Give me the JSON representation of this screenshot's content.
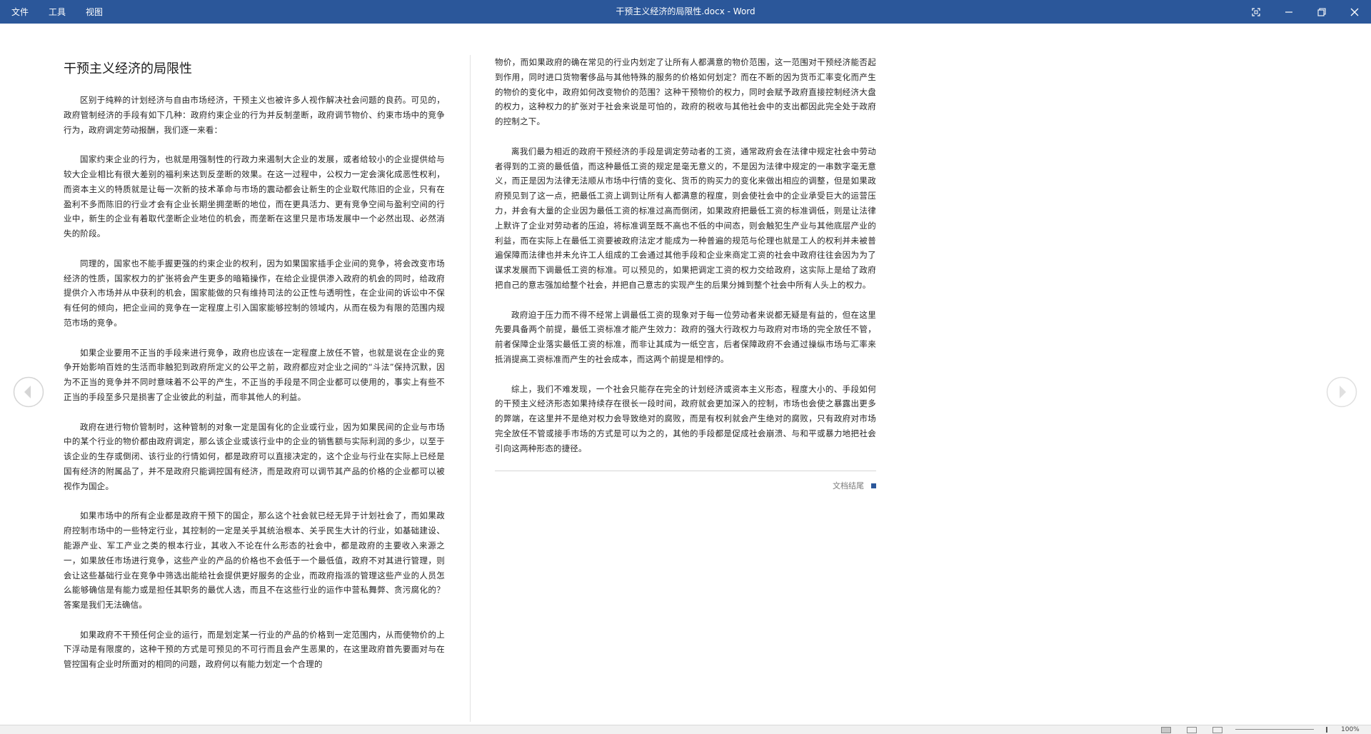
{
  "titlebar": {
    "menu": [
      "文件",
      "工具",
      "视图"
    ],
    "title": "干预主义经济的局限性.docx - Word"
  },
  "document": {
    "heading": "干预主义经济的局限性",
    "left_paragraphs": [
      "区别于纯粹的计划经济与自由市场经济，干预主义也被许多人视作解决社会问题的良药。可见的，政府管制经济的手段有如下几种：政府约束企业的行为并反制垄断，政府调节物价、约束市场中的竞争行为，政府调定劳动报酬，我们逐一来看：",
      "国家约束企业的行为，也就是用强制性的行政力来遏制大企业的发展，或者给较小的企业提供给与较大企业相比有很大差别的福利来达到反垄断的效果。在这一过程中，公权力一定会演化成恶性权利，而资本主义的特质就是让每一次新的技术革命与市场的震动都会让新生的企业取代陈旧的企业，只有在盈利不多而陈旧的行业才会有企业长期坐拥垄断的地位，而在更具活力、更有竞争空间与盈利空间的行业中，新生的企业有着取代垄断企业地位的机会，而垄断在这里只是市场发展中一个必然出现、必然消失的阶段。",
      "同理的，国家也不能手握更强的约束企业的权利，因为如果国家插手企业间的竞争，将会改变市场经济的性质，国家权力的扩张将会产生更多的暗箱操作，在给企业提供渗入政府的机会的同时，给政府提供介入市场并从中获利的机会，国家能做的只有维持司法的公正性与透明性，在企业间的诉讼中不保有任何的倾向，把企业间的竞争在一定程度上引入国家能够控制的领域内，从而在极为有限的范围内规范市场的竞争。",
      "如果企业要用不正当的手段来进行竞争，政府也应该在一定程度上放任不管，也就是说在企业的竞争开始影响百姓的生活而非触犯到政府所定义的公平之前，政府都应对企业之间的“斗法”保持沉默，因为不正当的竞争并不同时意味着不公平的产生，不正当的手段是不同企业都可以使用的，事实上有些不正当的手段至多只是损害了企业彼此的利益，而非其他人的利益。",
      "政府在进行物价管制时，这种管制的对象一定是国有化的企业或行业，因为如果民间的企业与市场中的某个行业的物价都由政府调定，那么该企业或该行业中的企业的销售额与实际利润的多少，以至于该企业的生存或倒闭、该行业的行情如何，都是政府可以直接决定的，这个企业与行业在实际上已经是国有经济的附属品了，并不是政府只能调控国有经济，而是政府可以调节其产品的价格的企业都可以被视作为国企。",
      "如果市场中的所有企业都是政府干预下的国企，那么这个社会就已经无异于计划社会了，而如果政府控制市场中的一些特定行业，其控制的一定是关乎其统治根本、关乎民生大计的行业，如基础建设、能源产业、军工产业之类的根本行业，其收入不论在什么形态的社会中，都是政府的主要收入来源之一，如果放任市场进行竞争，这些产业的产品的价格也不会低于一个最低值，政府不对其进行管理，则会让这些基础行业在竞争中筛选出能给社会提供更好服务的企业，而政府指派的管理这些产业的人员怎么能够确信是有能力或是担任其职务的最优人选，而且不在这些行业的运作中营私舞弊、贪污腐化的？答案是我们无法确信。",
      "如果政府不干预任何企业的运行，而是划定某一行业的产品的价格到一定范围内，从而使物价的上下浮动是有限度的，这种干预的方式是可预见的不可行而且会产生恶果的，在这里政府首先要面对与在管控国有企业时所面对的相同的问题，政府何以有能力划定一个合理的"
    ],
    "right_paragraphs": [
      "物价，而如果政府的确在常见的行业内划定了让所有人都满意的物价范围，这一范围对干预经济能否起到作用，同时进口货物奢侈品与其他特殊的服务的价格如何划定？而在不断的因为货币汇率变化而产生的物价的变化中，政府如何改变物价的范围？这种干预物价的权力，同时会赋予政府直接控制经济大盘的权力，这种权力的扩张对于社会来说是可怕的，政府的税收与其他社会中的支出都因此完全处于政府的控制之下。",
      "离我们最为相近的政府干预经济的手段是调定劳动者的工资，通常政府会在法律中规定社会中劳动者得到的工资的最低值，而这种最低工资的规定是毫无意义的，不是因为法律中规定的一串数字毫无意义，而正是因为法律无法顺从市场中行情的变化、货币的购买力的变化来做出相应的调整，但是如果政府预见到了这一点，把最低工资上调到让所有人都满意的程度，则会使社会中的企业承受巨大的运营压力，并会有大量的企业因为最低工资的标准过高而倒闭，如果政府把最低工资的标准调低，则是让法律上默许了企业对劳动者的压迫，将标准调至既不高也不低的中间态，则会触犯生产业与其他底层产业的利益，而在实际上在最低工资要被政府法定才能成为一种普遍的规范与伦理也就是工人的权利并未被普遍保障而法律也并未允许工人组成的工会通过其他手段和企业来商定工资的社会中政府往往会因为为了谋求发展而下调最低工资的标准。可以预见的，如果把调定工资的权力交给政府，这实际上是给了政府把自己的意志强加给整个社会，并把自己意志的实现产生的后果分摊到整个社会中所有人头上的权力。",
      "政府迫于压力而不得不经常上调最低工资的现象对于每一位劳动者来说都无疑是有益的，但在这里先要具备两个前提，最低工资标准才能产生效力：政府的强大行政权力与政府对市场的完全放任不管，前者保障企业落实最低工资的标准，而非让其成为一纸空言，后者保障政府不会通过操纵市场与汇率来抵消提高工资标准而产生的社会成本，而这两个前提是相悖的。",
      "综上，我们不难发现，一个社会只能存在完全的计划经济或资本主义形态，程度大小的、手段如何的干预主义经济形态如果持续存在很长一段时间，政府就会更加深入的控制，市场也会使之暴露出更多的弊端，在这里并不是绝对权力会导致绝对的腐败，而是有权利就会产生绝对的腐败，只有政府对市场完全放任不管或接手市场的方式是可以为之的，其他的手段都是促成社会崩溃、与和平或暴力地把社会引向这两种形态的捷径。"
    ],
    "end_label": "文档结尾"
  },
  "statusbar": {
    "zoom": "100%"
  },
  "colors": {
    "titlebar": "#2b579a",
    "text": "#262626"
  }
}
